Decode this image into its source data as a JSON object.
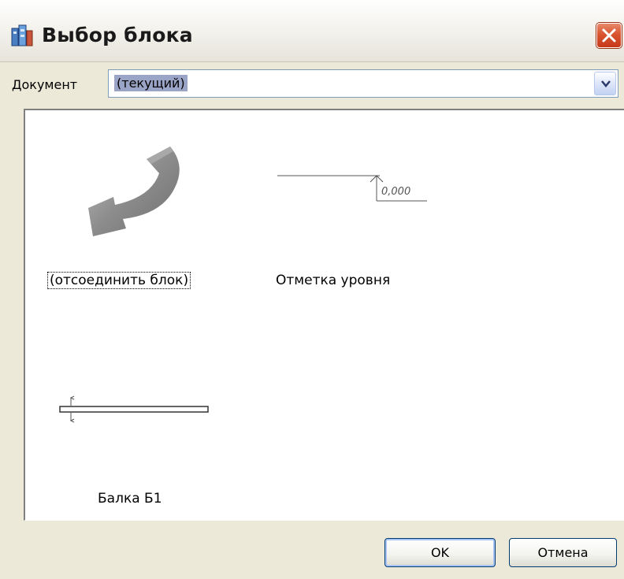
{
  "window": {
    "title": "Выбор блока",
    "icon": "app-block-icon"
  },
  "document": {
    "label": "Документ",
    "selected_value": "(текущий)"
  },
  "blocks": [
    {
      "name": "(отсоединить блок)",
      "icon": "detach-block-arrow-icon",
      "selected": true
    },
    {
      "name": "Отметка уровня",
      "icon": "level-mark-preview",
      "preview_text": "0,000"
    },
    {
      "name": "Балка Б1",
      "icon": "beam-preview"
    }
  ],
  "buttons": {
    "ok": "OK",
    "cancel": "Отмена"
  },
  "colors": {
    "close_button": "#d9542f",
    "selection_highlight": "#9aa4c6",
    "dialog_background": "#ece9d8"
  }
}
